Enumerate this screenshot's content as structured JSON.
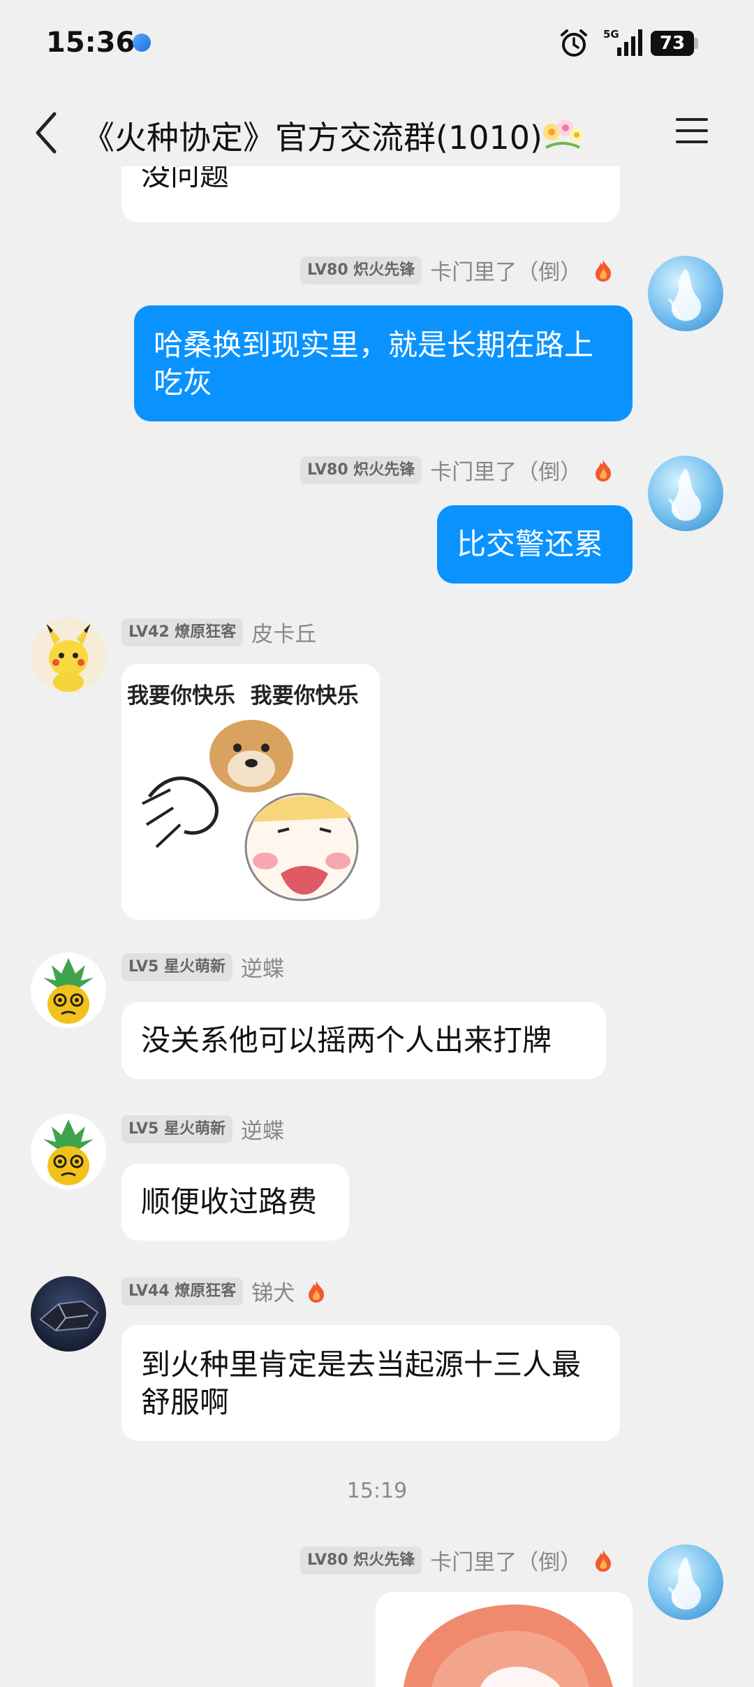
{
  "status": {
    "time": "15:36",
    "network": "5G",
    "battery": "73"
  },
  "header": {
    "title": "《火种协定》官方交流群(1010)"
  },
  "messages": {
    "m0": {
      "text": "没问题"
    },
    "m1": {
      "badge": "LV80 炽火先锋",
      "nick": "卡门里了（倒）",
      "text": "哈桑换到现实里，就是长期在路上吃灰"
    },
    "m2": {
      "badge": "LV80 炽火先锋",
      "nick": "卡门里了（倒）",
      "text": "比交警还累"
    },
    "m3": {
      "badge": "LV42 燎原狂客",
      "nick": "皮卡丘",
      "sticker_text": "我要你快乐  我要你快乐"
    },
    "m4": {
      "badge": "LV5 星火萌新",
      "nick": "逆蝶",
      "text": "没关系他可以摇两个人出来打牌"
    },
    "m5": {
      "badge": "LV5 星火萌新",
      "nick": "逆蝶",
      "text": "顺便收过路费"
    },
    "m6": {
      "badge": "LV44 燎原狂客",
      "nick": "锑犬",
      "text": "到火种里肯定是去当起源十三人最舒服啊"
    },
    "separator": {
      "time": "15:19"
    },
    "m7": {
      "badge": "LV80 炽火先锋",
      "nick": "卡门里了（倒）"
    }
  }
}
